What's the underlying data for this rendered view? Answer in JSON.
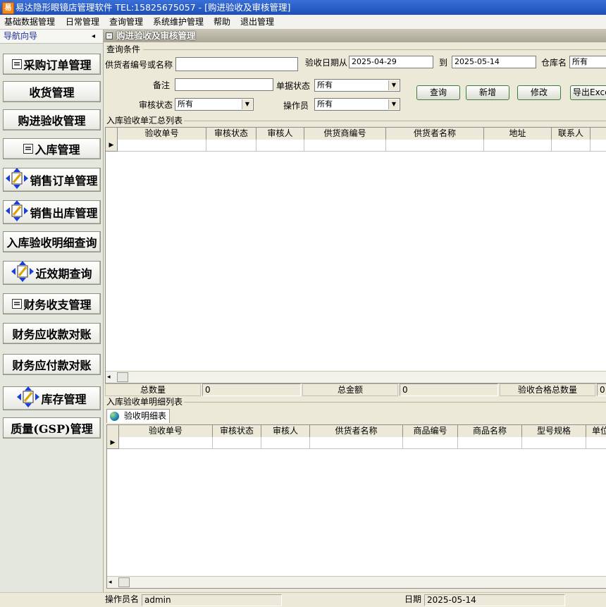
{
  "window": {
    "title": "易达隐形眼镜店管理软件 TEL:15825675057 - [购进验收及审核管理]"
  },
  "menu": [
    "基础数据管理",
    "日常管理",
    "查询管理",
    "系统维护管理",
    "帮助",
    "退出管理"
  ],
  "nav": {
    "title": "导航向导",
    "collapse": "◂",
    "items": [
      {
        "label": "采购订单管理",
        "icon": "document-icon"
      },
      {
        "label": "收货管理",
        "icon": ""
      },
      {
        "label": "购进验收管理",
        "icon": ""
      },
      {
        "label": "入库管理",
        "icon": "document-icon"
      },
      {
        "label": "销售订单管理",
        "icon": "move-arrows-icon"
      },
      {
        "label": "销售出库管理",
        "icon": "move-arrows-icon"
      },
      {
        "label": "入库验收明细查询",
        "icon": ""
      },
      {
        "label": "近效期查询",
        "icon": "move-arrows-icon"
      },
      {
        "label": "财务收支管理",
        "icon": "document-icon"
      },
      {
        "label": "财务应收款对账",
        "icon": ""
      },
      {
        "label": "财务应付款对账",
        "icon": ""
      },
      {
        "label": "库存管理",
        "icon": "move-arrows-icon"
      },
      {
        "label": "质量(GSP)管理",
        "icon": ""
      }
    ]
  },
  "doc": {
    "title": "购进验收及审核管理"
  },
  "query": {
    "group_label": "查询条件",
    "supplier_label": "供货者编号或名称",
    "supplier_value": "",
    "date_from_label": "验收日期从",
    "date_from": "2025-04-29",
    "date_to_label": "到",
    "date_to": "2025-05-14",
    "warehouse_label": "仓库名",
    "warehouse_value": "所有",
    "remark_label": "备注",
    "remark_value": "",
    "doc_status_label": "单据状态",
    "doc_status_value": "所有",
    "audit_status_label": "审核状态",
    "audit_status_value": "所有",
    "operator_label": "操作员",
    "operator_value": "所有",
    "buttons": {
      "query": "查询",
      "add": "新增",
      "edit": "修改",
      "export": "导出Excel"
    }
  },
  "summary_table": {
    "group_label": "入库验收单汇总列表",
    "columns": [
      "验收单号",
      "审核状态",
      "审核人",
      "供货商编号",
      "供货者名称",
      "地址",
      "联系人"
    ]
  },
  "totals": {
    "qty_label": "总数量",
    "qty_value": "0",
    "amount_label": "总金额",
    "amount_value": "0",
    "pass_label": "验收合格总数量",
    "pass_value": "0"
  },
  "detail_table": {
    "group_label": "入库验收单明细列表",
    "tab_label": "验收明细表",
    "columns": [
      "验收单号",
      "审核状态",
      "审核人",
      "供货者名称",
      "商品编号",
      "商品名称",
      "型号规格",
      "单位"
    ]
  },
  "status": {
    "operator_label": "操作员名",
    "operator_value": "admin",
    "date_label": "日期",
    "date_value": "2025-05-14"
  }
}
